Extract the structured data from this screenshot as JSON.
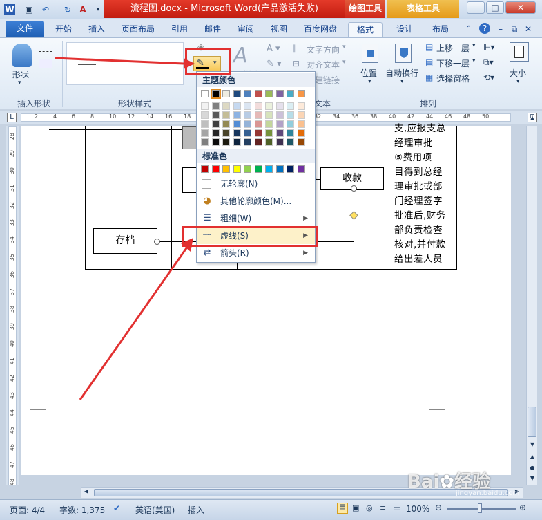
{
  "titlebar": {
    "doc_title": "流程图.docx - Microsoft Word(产品激活失败)",
    "ctx_draw": "绘图工具",
    "ctx_table": "表格工具"
  },
  "tabs": {
    "file": "文件",
    "items": [
      "开始",
      "插入",
      "页面布局",
      "引用",
      "邮件",
      "审阅",
      "视图",
      "百度网盘",
      "格式",
      "设计",
      "布局"
    ],
    "active": "格式"
  },
  "ribbon": {
    "insert_shape": {
      "shape_label": "形状",
      "group": "插入形状"
    },
    "shape_styles": {
      "group": "形状样式"
    },
    "wordart": {
      "text_dir": "文字方向",
      "align_text": "对齐文本",
      "create_link": "建链接",
      "group": "文本",
      "quick_styles": "速样式"
    },
    "arrange": {
      "position": "位置",
      "wrap": "自动换行",
      "bring_forward": "上移一层",
      "send_backward": "下移一层",
      "selection_pane": "选择窗格",
      "group": "排列"
    },
    "size": {
      "label": "大小"
    }
  },
  "ruler": {
    "h_ticks": [
      "2",
      "4",
      "6",
      "8",
      "10",
      "12",
      "14",
      "16",
      "18",
      "20",
      "22",
      "24",
      "26",
      "28",
      "30",
      "32",
      "34",
      "36",
      "38",
      "40",
      "42",
      "44",
      "46",
      "48",
      "50"
    ],
    "v_ticks": [
      "28",
      "29",
      "30",
      "31",
      "32",
      "33",
      "34",
      "35",
      "36",
      "37",
      "38",
      "39",
      "40",
      "41",
      "42",
      "43",
      "44",
      "45",
      "46",
      "47",
      "48"
    ]
  },
  "document": {
    "box_receipt": "收款",
    "box_archive": "存档",
    "right_text": [
      "支,应报支总",
      "经理审批",
      "⑤费用项",
      "目得到总经",
      "理审批或部",
      "门经理签字",
      "批准后,财务",
      "部负责检查",
      "核对,并付款",
      "给出差人员"
    ]
  },
  "menu": {
    "theme_header": "主题颜色",
    "std_header": "标准色",
    "theme_top": [
      "#ffffff",
      "#000000",
      "#eeece1",
      "#1f497d",
      "#4f81bd",
      "#c0504d",
      "#9bbb59",
      "#8064a2",
      "#4bacc6",
      "#f79646"
    ],
    "theme_cols": [
      [
        "#f2f2f2",
        "#d8d8d8",
        "#bfbfbf",
        "#a5a5a5",
        "#7f7f7f"
      ],
      [
        "#7f7f7f",
        "#595959",
        "#3f3f3f",
        "#262626",
        "#0c0c0c"
      ],
      [
        "#ddd9c3",
        "#c4bd97",
        "#938953",
        "#494429",
        "#1d1b10"
      ],
      [
        "#c6d9f0",
        "#8db3e2",
        "#548dd4",
        "#17365d",
        "#0f243e"
      ],
      [
        "#dbe5f1",
        "#b8cce4",
        "#95b3d7",
        "#366092",
        "#244061"
      ],
      [
        "#f2dcdb",
        "#e5b9b7",
        "#d99694",
        "#953734",
        "#632423"
      ],
      [
        "#ebf1dd",
        "#d7e3bc",
        "#c3d69b",
        "#76923c",
        "#4f6128"
      ],
      [
        "#e5e0ec",
        "#ccc1d9",
        "#b2a2c7",
        "#5f497a",
        "#3f3151"
      ],
      [
        "#dbeef3",
        "#b7dde8",
        "#92cddc",
        "#31859b",
        "#205867"
      ],
      [
        "#fdeada",
        "#fbd5b5",
        "#fac08f",
        "#e36c09",
        "#974806"
      ]
    ],
    "std_colors": [
      "#c00000",
      "#ff0000",
      "#ffc000",
      "#ffff00",
      "#92d050",
      "#00b050",
      "#00b0f0",
      "#0070c0",
      "#002060",
      "#7030a0"
    ],
    "no_outline": "无轮廓(N)",
    "more_colors": "其他轮廓颜色(M)...",
    "weight": "粗细(W)",
    "dashes": "虚线(S)",
    "arrows": "箭头(R)"
  },
  "status": {
    "page": "页面: 4/4",
    "words": "字数: 1,375",
    "lang": "英语(美国)",
    "insert": "插入",
    "zoom": "100%"
  },
  "watermark": {
    "brand": "Bai",
    "brand2": "经验",
    "url": "jingyan.baidu.com"
  }
}
